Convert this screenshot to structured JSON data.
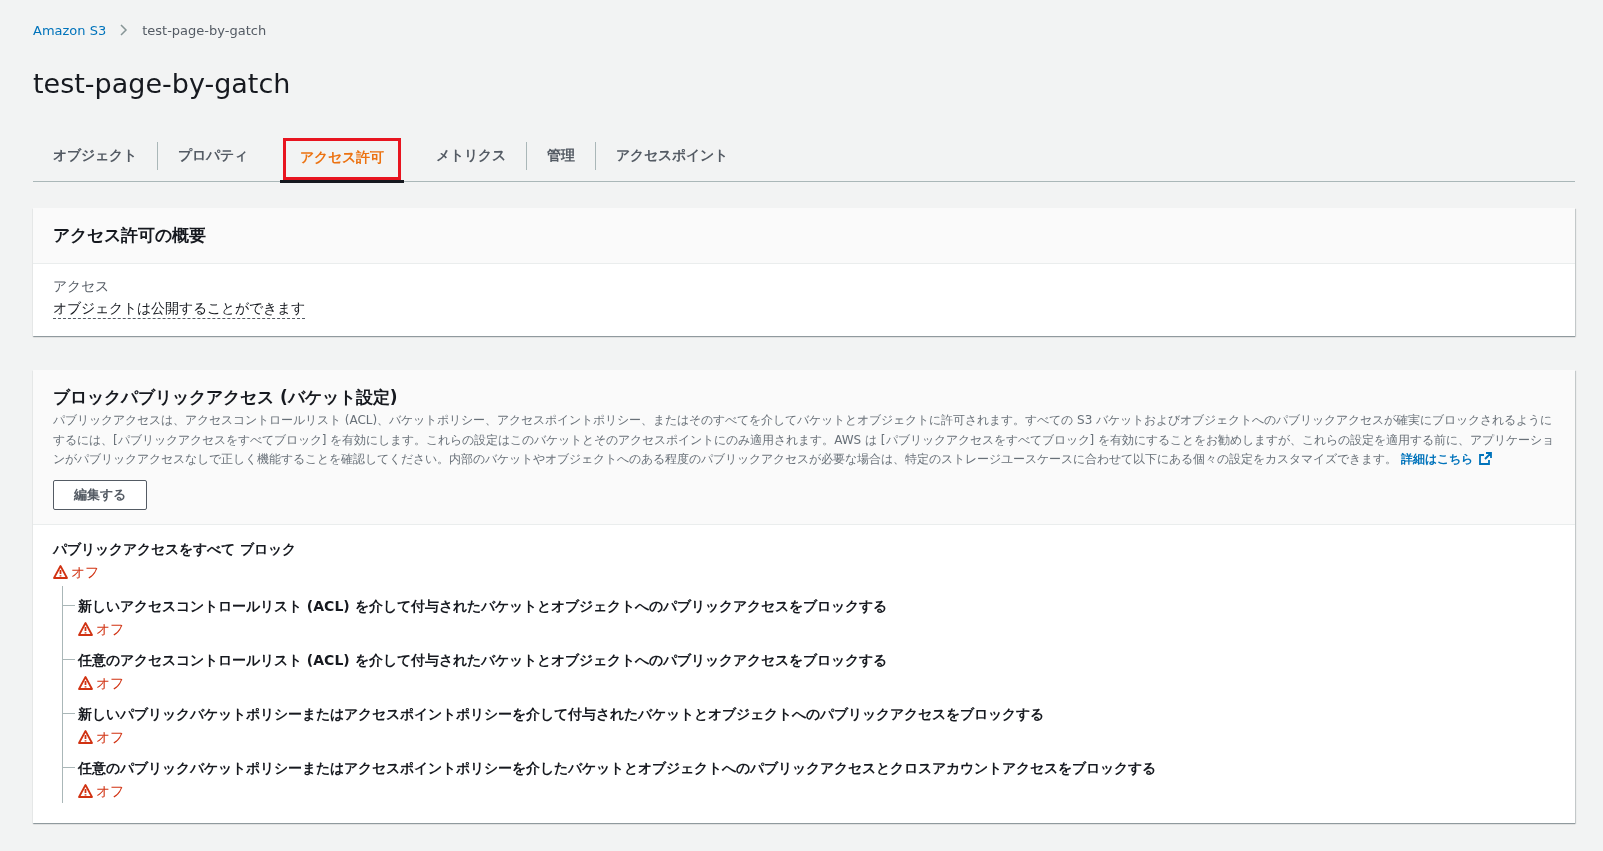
{
  "breadcrumb": [
    {
      "label": "Amazon S3",
      "link": true
    },
    {
      "label": "test-page-by-gatch",
      "link": false
    }
  ],
  "title": "test-page-by-gatch",
  "tabs": [
    {
      "label": "オブジェクト",
      "selected": false,
      "highlighted": false
    },
    {
      "label": "プロパティ",
      "selected": false,
      "highlighted": false
    },
    {
      "label": "アクセス許可",
      "selected": true,
      "highlighted": true
    },
    {
      "label": "メトリクス",
      "selected": false,
      "highlighted": false
    },
    {
      "label": "管理",
      "selected": false,
      "highlighted": false
    },
    {
      "label": "アクセスポイント",
      "selected": false,
      "highlighted": false
    }
  ],
  "overview": {
    "title": "アクセス許可の概要",
    "label": "アクセス",
    "value": "オブジェクトは公開することができます"
  },
  "block_public_access": {
    "title": "ブロックパブリックアクセス (バケット設定)",
    "description": "パブリックアクセスは、アクセスコントロールリスト (ACL)、バケットポリシー、アクセスポイントポリシー、またはそのすべてを介してバケットとオブジェクトに許可されます。すべての S3 バケットおよびオブジェクトへのパブリックアクセスが確実にブロックされるようにするには、[パブリックアクセスをすべてブロック] を有効にします。これらの設定はこのバケットとそのアクセスポイントにのみ適用されます。AWS は [パブリックアクセスをすべてブロック] を有効にすることをお勧めしますが、これらの設定を適用する前に、アプリケーションがパブリックアクセスなしで正しく機能することを確認してください。内部のバケットやオブジェクトへのある程度のパブリックアクセスが必要な場合は、特定のストレージユースケースに合わせて以下にある個々の設定をカスタマイズできます。",
    "link": "詳細はこちら",
    "edit_button": "編集する",
    "setting": {
      "label": "パブリックアクセスをすべて ブロック",
      "enabled": false,
      "status": "オフ",
      "children": [
        {
          "label": "新しいアクセスコントロールリスト (ACL) を介して付与されたバケットとオブジェクトへのパブリックアクセスをブロックする",
          "enabled": false,
          "status": "オフ"
        },
        {
          "label": "任意のアクセスコントロールリスト (ACL) を介して付与されたバケットとオブジェクトへのパブリックアクセスをブロックする",
          "enabled": false,
          "status": "オフ"
        },
        {
          "label": "新しいパブリックバケットポリシーまたはアクセスポイントポリシーを介して付与されたバケットとオブジェクトへのパブリックアクセスをブロックする",
          "enabled": false,
          "status": "オフ"
        },
        {
          "label": "任意のパブリックバケットポリシーまたはアクセスポイントポリシーを介したバケットとオブジェクトへのパブリックアクセスとクロスアカウントアクセスをブロックする",
          "enabled": false,
          "status": "オフ"
        }
      ]
    }
  }
}
